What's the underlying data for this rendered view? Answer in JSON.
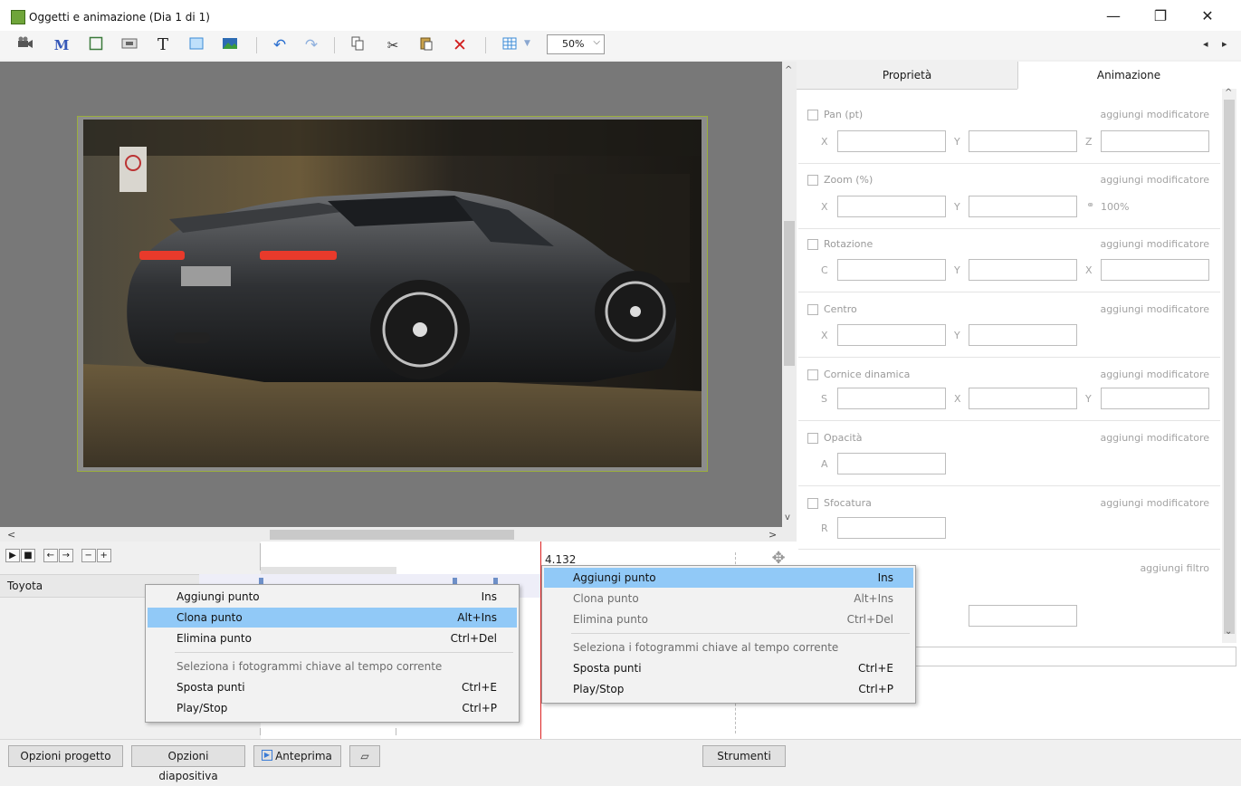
{
  "window": {
    "title": "Oggetti e animazione (Dia 1 di 1)",
    "controls": {
      "minimize": "—",
      "maximize": "❐",
      "close": "✕"
    }
  },
  "toolbar": {
    "zoom": "50%",
    "nav_prev": "◂",
    "nav_next": "▸",
    "icons": [
      "camera-icon",
      "mask-icon",
      "frame-icon",
      "button-icon",
      "text-icon",
      "rectangle-icon",
      "image-icon",
      "undo-icon",
      "redo-icon",
      "copy-icon",
      "cut-icon",
      "paste-icon",
      "delete-icon",
      "grid-icon"
    ]
  },
  "canvas": {
    "scroll_left": "<",
    "scroll_right": ">",
    "scroll_up": "^",
    "scroll_down": "v"
  },
  "panel": {
    "tabs": [
      "Proprietà",
      "Animazione"
    ],
    "active_tab": "Animazione",
    "groups": {
      "pan": {
        "label": "Pan (pt)",
        "action": "aggiungi modificatore",
        "f1": "X",
        "f2": "Y",
        "f3": "Z"
      },
      "zoom": {
        "label": "Zoom (%)",
        "action": "aggiungi modificatore",
        "f1": "X",
        "f2": "Y",
        "link_value": "100%"
      },
      "rotation": {
        "label": "Rotazione",
        "action": "aggiungi modificatore",
        "f1": "C",
        "f2": "Y",
        "f3": "X"
      },
      "center": {
        "label": "Centro",
        "action": "aggiungi modificatore",
        "f1": "X",
        "f2": "Y"
      },
      "dynframe": {
        "label": "Cornice dinamica",
        "action": "aggiungi modificatore",
        "f1": "S",
        "f2": "X",
        "f3": "Y"
      },
      "opacity": {
        "label": "Opacità",
        "action": "aggiungi modificatore",
        "f1": "A"
      },
      "blur": {
        "label": "Sfocatura",
        "action": "aggiungi modificatore",
        "f1": "R"
      },
      "filter": {
        "action": "aggiungi filtro"
      }
    }
  },
  "timeline": {
    "object_name": "Toyota",
    "current_time": "4.132",
    "buttons": [
      "▶",
      "■",
      "←",
      "→",
      "−",
      "+"
    ]
  },
  "menu_left": {
    "items": [
      {
        "label": "Aggiungi punto",
        "shortcut": "Ins"
      },
      {
        "label": "Clona punto",
        "shortcut": "Alt+Ins",
        "highlighted": true
      },
      {
        "label": "Elimina punto",
        "shortcut": "Ctrl+Del"
      },
      {
        "label": "Seleziona i fotogrammi chiave al tempo corrente",
        "shortcut": "",
        "disabled": true
      },
      {
        "label": "Sposta punti",
        "shortcut": "Ctrl+E"
      },
      {
        "label": "Play/Stop",
        "shortcut": "Ctrl+P"
      }
    ]
  },
  "menu_right": {
    "items": [
      {
        "label": "Aggiungi punto",
        "shortcut": "Ins",
        "highlighted": true
      },
      {
        "label": "Clona punto",
        "shortcut": "Alt+Ins",
        "disabled": true
      },
      {
        "label": "Elimina punto",
        "shortcut": "Ctrl+Del",
        "disabled": true
      },
      {
        "label": "Seleziona i fotogrammi chiave al tempo corrente",
        "shortcut": "",
        "disabled": true
      },
      {
        "label": "Sposta punti",
        "shortcut": "Ctrl+E"
      },
      {
        "label": "Play/Stop",
        "shortcut": "Ctrl+P"
      }
    ]
  },
  "bottom": {
    "project_options": "Opzioni progetto",
    "slide_options": "Opzioni diapositiva",
    "preview": "Anteprima",
    "tools": "Strumenti"
  },
  "colors": {
    "highlight": "#91c9f7",
    "playhead": "#dd2222",
    "slide_border": "#9aae3d"
  }
}
